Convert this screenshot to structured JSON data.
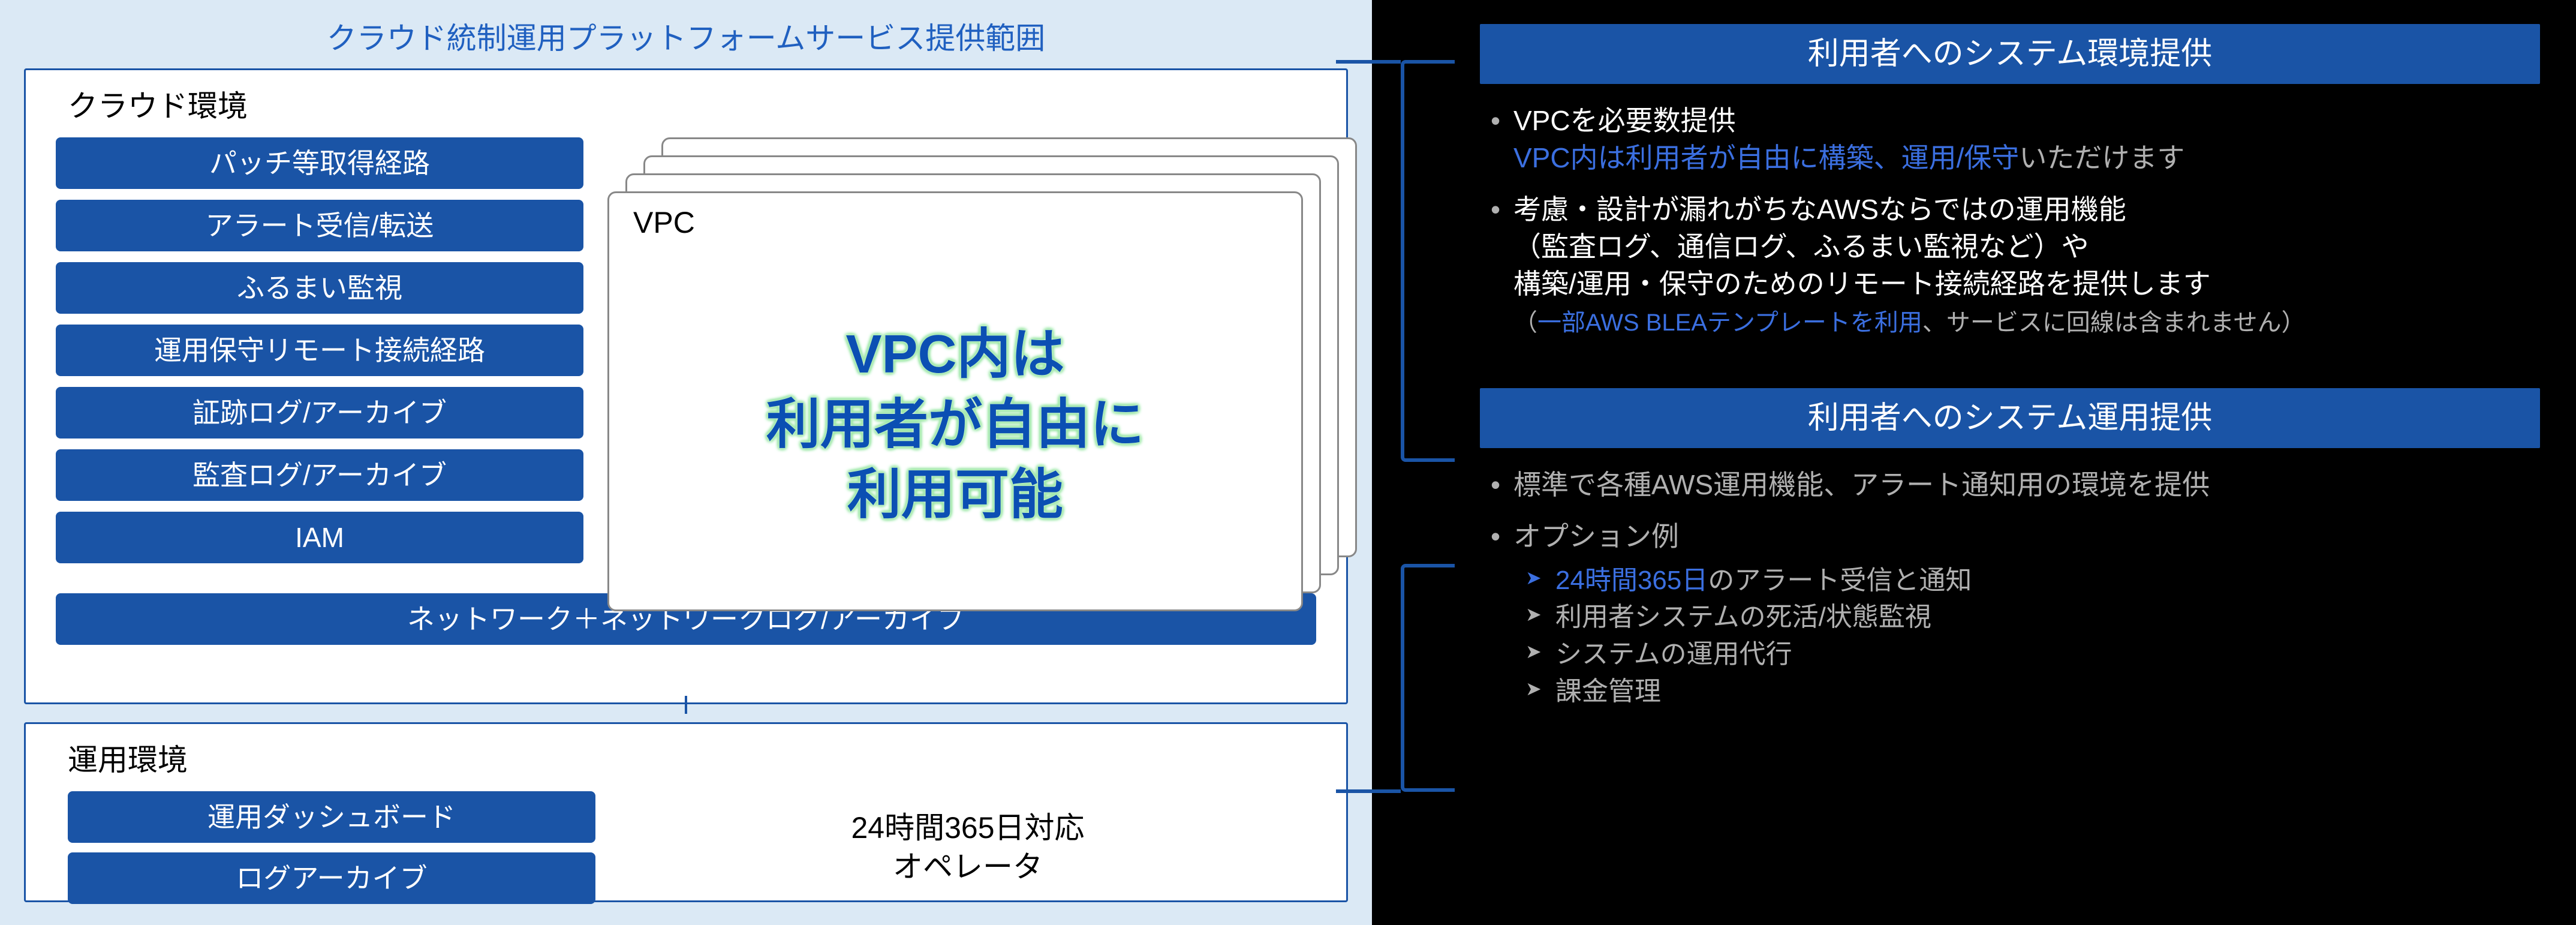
{
  "left": {
    "title": "クラウド統制運用プラットフォームサービス提供範囲",
    "cloud": {
      "label": "クラウド環境",
      "features": [
        "パッチ等取得経路",
        "アラート受信/転送",
        "ふるまい監視",
        "運用保守リモート接続経路",
        "証跡ログ/アーカイブ",
        "監査ログ/アーカイブ",
        "IAM"
      ],
      "network": "ネットワーク＋ネットワークログ/アーカイブ",
      "vpc_label": "VPC",
      "vpc_big_1": "VPC内は",
      "vpc_big_2": "利用者が自由に",
      "vpc_big_3": "利用可能"
    },
    "ops": {
      "label": "運用環境",
      "items": [
        "運用ダッシュボード",
        "ログアーカイブ"
      ],
      "operator_1": "24時間365日対応",
      "operator_2": "オペレータ"
    }
  },
  "right": {
    "env": {
      "header": "利用者へのシステム環境提供",
      "b1_white": "VPCを必要数提供",
      "b1_blue": "VPC内は利用者が自由に構築、運用/保守",
      "b1_tail": "いただけます",
      "b2_l1": "考慮・設計が漏れがちなAWSならではの運用機能",
      "b2_l2": "（監査ログ、通信ログ、ふるまい監視など）や",
      "b2_l3": "構築/運用・保守のためのリモート接続経路を提供します",
      "b2_note_blue": "一部AWS BLEAテンプレートを利用",
      "b2_note_tail": "、サービスに回線は含まれません）",
      "b2_note_head": "（"
    },
    "ops": {
      "header": "利用者へのシステム運用提供",
      "b1": "標準で各種AWS運用機能、アラート通知用の環境を提供",
      "b2": "オプション例",
      "sub1_blue": "24時間365日",
      "sub1_tail": "のアラート受信と通知",
      "sub2": "利用者システムの死活/状態監視",
      "sub3": "システムの運用代行",
      "sub4": "課金管理"
    }
  }
}
